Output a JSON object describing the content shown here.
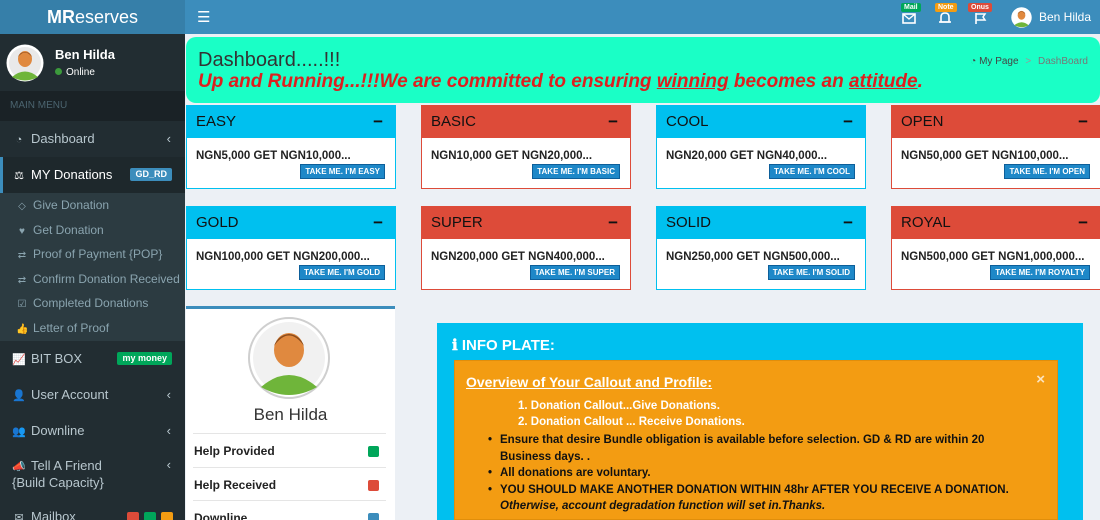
{
  "app": {
    "logo_bold": "MR",
    "logo_rest": "eserves"
  },
  "user": {
    "name": "Ben Hilda",
    "status": "Online"
  },
  "sidebar": {
    "section_header": "MAIN MENU",
    "dashboard": "Dashboard",
    "my_donations": "MY Donations",
    "my_donations_badge": "GD_RD",
    "sub_items": [
      {
        "label": "Give Donation",
        "icon": "diamond-icon"
      },
      {
        "label": "Get Donation",
        "icon": "heart-icon"
      },
      {
        "label": "Proof of Payment {POP}",
        "icon": "exchange-icon"
      },
      {
        "label": "Confirm Donation Received",
        "icon": "exchange-icon"
      },
      {
        "label": "Completed Donations",
        "icon": "check-square-icon"
      },
      {
        "label": "Letter of Proof",
        "icon": "thumbs-up-icon"
      }
    ],
    "bit_box": "BIT BOX",
    "bit_box_badge": "my money",
    "user_account": "User Account",
    "downline": "Downline",
    "tell_friend_1": "Tell A Friend",
    "tell_friend_2": "{Build Capacity}",
    "mailbox": "Mailbox"
  },
  "topbar": {
    "mail_badge": "Mail",
    "note_badge": "Note",
    "onus_badge": "Onus",
    "user_name": "Ben Hilda"
  },
  "dashboard": {
    "title": "Dashboard.....!!!",
    "subtitle_a": "Up and Running...!!!We are committed to ensuring ",
    "subtitle_u1": "winning",
    "subtitle_b": " becomes an ",
    "subtitle_u2": "attitude",
    "subtitle_c": ".",
    "crumb_home": "My Page",
    "crumb_sep": ">",
    "crumb_current": "DashBoard"
  },
  "boxes": [
    {
      "title": "EASY",
      "text": "NGN5,000 GET NGN10,000...",
      "button": "TAKE ME. I'M EASY",
      "color": "#00c0ef"
    },
    {
      "title": "BASIC",
      "text": "NGN10,000 GET NGN20,000...",
      "button": "TAKE ME. I'M BASIC",
      "color": "#dd4b39"
    },
    {
      "title": "COOL",
      "text": "NGN20,000 GET NGN40,000...",
      "button": "TAKE ME. I'M COOL",
      "color": "#00c0ef"
    },
    {
      "title": "OPEN",
      "text": "NGN50,000 GET NGN100,000...",
      "button": "TAKE ME. I'M OPEN",
      "color": "#dd4b39"
    },
    {
      "title": "GOLD",
      "text": "NGN100,000 GET NGN200,000...",
      "button": "TAKE ME. I'M GOLD",
      "color": "#00c0ef"
    },
    {
      "title": "SUPER",
      "text": "NGN200,000 GET NGN400,000...",
      "button": "TAKE ME. I'M SUPER",
      "color": "#dd4b39"
    },
    {
      "title": "SOLID",
      "text": "NGN250,000 GET NGN500,000...",
      "button": "TAKE ME. I'M SOLID",
      "color": "#00c0ef"
    },
    {
      "title": "ROYAL",
      "text": "NGN500,000 GET NGN1,000,000...",
      "button": "TAKE ME. I'M ROYALTY",
      "color": "#dd4b39"
    }
  ],
  "box_minimize": "−",
  "profile": {
    "name": "Ben Hilda",
    "rows": [
      "Help Provided",
      "Help Received",
      "Downline"
    ]
  },
  "info": {
    "title": "INFO PLATE:",
    "heading": "Overview of Your Callout and Profile:",
    "close": "×",
    "ol": [
      "1. Donation Callout...Give Donations.",
      "2. Donation Callout ... Receive Donations."
    ],
    "ul": [
      "Ensure that desire Bundle obligation is available before selection. GD & RD are within 20 Business days. .",
      "All donations are voluntary.",
      "YOU SHOULD MAKE ANOTHER DONATION WITHIN 48hr AFTER YOU RECEIVE A DONATION."
    ],
    "ul_italic": "Otherwise, account degradation function will set in.Thanks."
  }
}
